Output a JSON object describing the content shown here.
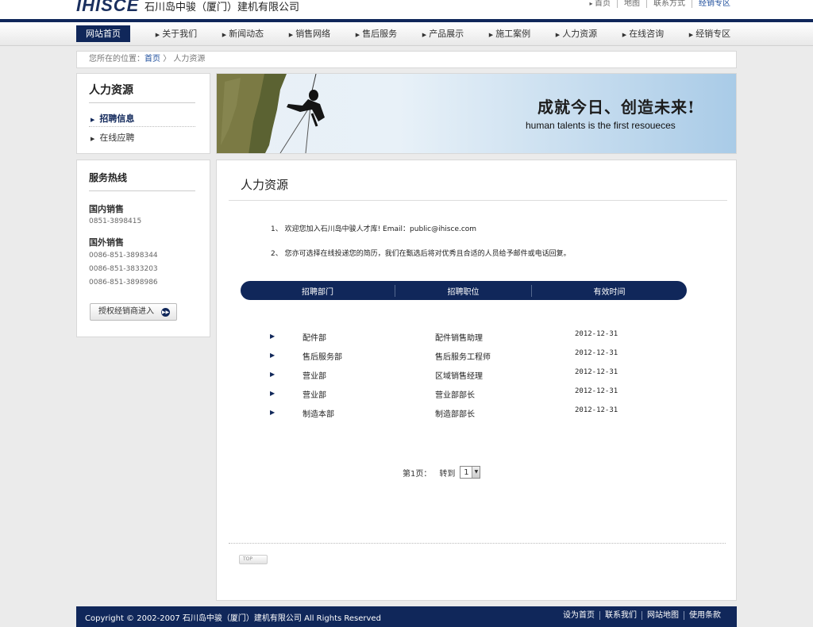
{
  "header": {
    "logo": "IHISCE",
    "company": "石川岛中骏（厦门）建机有限公司",
    "toplinks": [
      "首页",
      "地图",
      "联系方式",
      "经销专区"
    ]
  },
  "nav": [
    "网站首页",
    "关于我们",
    "新闻动态",
    "销售网络",
    "售后服务",
    "产品展示",
    "施工案例",
    "人力资源",
    "在线咨询",
    "经销专区"
  ],
  "breadcrumb": {
    "prefix": "您所在的位置：",
    "home": "首页",
    "sep": "〉",
    "current": "人力资源"
  },
  "sidebar": {
    "title": "人力资源",
    "links": [
      "招聘信息",
      "在线应聘"
    ]
  },
  "hotline": {
    "title": "服务热线",
    "domestic_label": "国内销售",
    "domestic": [
      "0851-3898415"
    ],
    "overseas_label": "国外销售",
    "overseas": [
      "0086-851-3898344",
      "0086-851-3833203",
      "0086-851-3898986"
    ],
    "button": "授权经销商进入"
  },
  "banner": {
    "slogan_cn": "成就今日、创造未来!",
    "slogan_en": "human talents is the first resoueces"
  },
  "main": {
    "title": "人力资源",
    "intro": [
      "1、 欢迎您加入石川岛中骏人才库! Email：public@ihisce.com",
      "2、 您亦可选择在线投递您的简历，我们在甄选后将对优秀且合适的人员给予邮件或电话回复。"
    ],
    "columns": [
      "招聘部门",
      "招聘职位",
      "有效时间"
    ],
    "jobs": [
      {
        "dept": "配件部",
        "position": "配件销售助理",
        "date": "2012-12-31"
      },
      {
        "dept": "售后服务部",
        "position": "售后服务工程师",
        "date": "2012-12-31"
      },
      {
        "dept": "营业部",
        "position": "区域销售经理",
        "date": "2012-12-31"
      },
      {
        "dept": "营业部",
        "position": "营业部部长",
        "date": "2012-12-31"
      },
      {
        "dept": "制造本部",
        "position": "制造部部长",
        "date": "2012-12-31"
      }
    ],
    "pager": {
      "page": "第1页：",
      "goto": "转到",
      "selected": "1"
    },
    "top": "TOP"
  },
  "footer": {
    "copyright": "Copyright © 2002-2007 石川岛中骏（厦门）建机有限公司 All Rights Reserved",
    "links": [
      "设为首页",
      "联系我们",
      "网站地图",
      "使用条款"
    ]
  },
  "colors": {
    "navy": "#10275a",
    "link": "#1e4e9c",
    "bg": "#ebebeb"
  }
}
